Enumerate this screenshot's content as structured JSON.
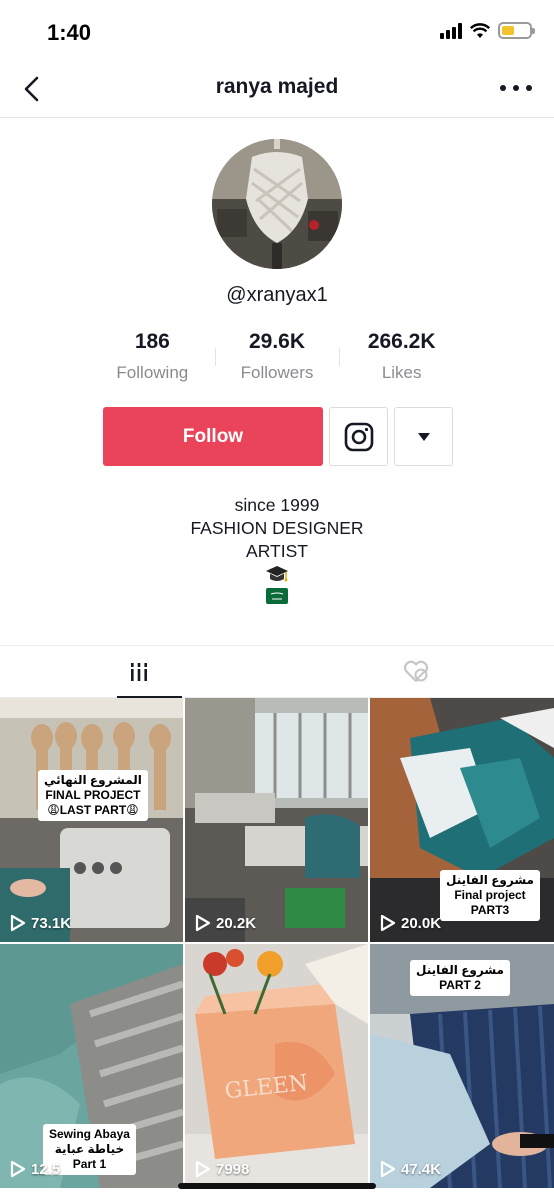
{
  "status_bar": {
    "time": "1:40"
  },
  "header": {
    "title": "ranya majed"
  },
  "profile": {
    "username": "@xranyax1",
    "stats": [
      {
        "value": "186",
        "label": "Following"
      },
      {
        "value": "29.6K",
        "label": "Followers"
      },
      {
        "value": "266.2K",
        "label": "Likes"
      }
    ],
    "follow_label": "Follow",
    "bio": [
      "since 1999",
      "FASHION DESIGNER",
      "ARTIST"
    ]
  },
  "colors": {
    "follow": "#ea445a",
    "text": "#161823",
    "muted": "#8a8b91"
  },
  "videos": [
    {
      "views": "73.1K",
      "caption": [
        "المشروع النهائي",
        "FINAL PROJECT",
        "😩LAST PART😩"
      ]
    },
    {
      "views": "20.2K",
      "caption": []
    },
    {
      "views": "20.0K",
      "caption": [
        "مشروع الفاينل",
        "Final project",
        "PART3"
      ]
    },
    {
      "views": "12.5",
      "caption": [
        "Sewing Abaya",
        "خياطة عباية",
        "Part 1"
      ]
    },
    {
      "views": "7998",
      "caption": [],
      "brand": "GLEEN"
    },
    {
      "views": "47.4K",
      "caption": [
        "مشروع الفاينل",
        "PART 2"
      ]
    }
  ]
}
